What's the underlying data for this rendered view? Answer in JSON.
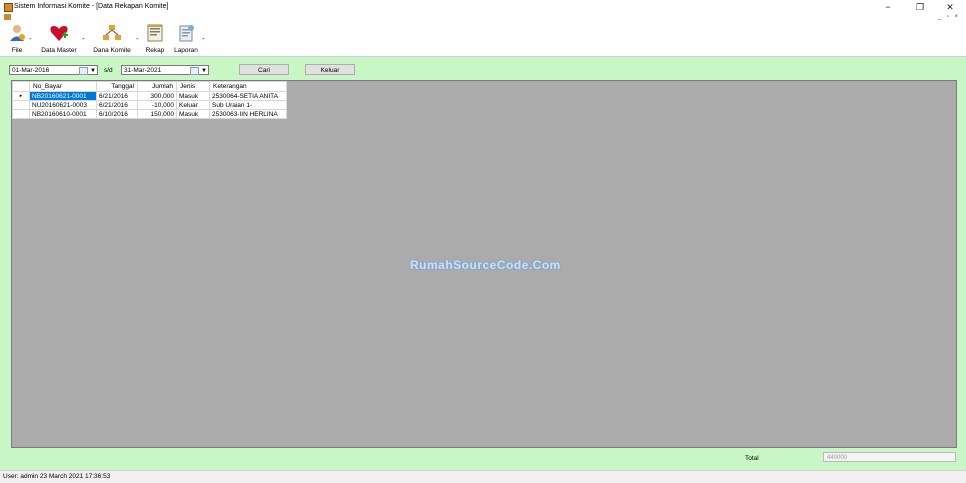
{
  "window": {
    "title": "Sistem Informasi Komite - [Data Rekapan Komite]",
    "minimize_glyph": "−",
    "restore_glyph": "❐",
    "close_glyph": "✕",
    "mdi_controls": "_ ▫ ×"
  },
  "toolbar": {
    "items": [
      {
        "label": "File",
        "icon": "user-icon"
      },
      {
        "label": "Data Master",
        "icon": "heart-add-icon"
      },
      {
        "label": "Dana Komite",
        "icon": "network-icon"
      },
      {
        "label": "Rekap",
        "icon": "report-icon"
      },
      {
        "label": "Laporan",
        "icon": "document-icon"
      }
    ],
    "separator": "-"
  },
  "filter": {
    "date_from": "01-Mar-2016",
    "between_label": "s/d",
    "date_to": "31-Mar-2021",
    "search_label": "Cari",
    "exit_label": "Keluar"
  },
  "table": {
    "columns": [
      "No_Bayar",
      "Tanggal",
      "Jumlah",
      "Jenis",
      "Keterangan"
    ],
    "rows": [
      {
        "no_bayar": "NB20160621-0001",
        "tanggal": "6/21/2016",
        "jumlah": "300,000",
        "jenis": "Masuk",
        "keterangan": "2530064-SETIA ANITA"
      },
      {
        "no_bayar": "NU20160621-0003",
        "tanggal": "6/21/2016",
        "jumlah": "-10,000",
        "jenis": "Keluar",
        "keterangan": "Sub Uraian 1-"
      },
      {
        "no_bayar": "NB20160610-0001",
        "tanggal": "6/10/2016",
        "jumlah": "150,000",
        "jenis": "Masuk",
        "keterangan": "2530063-IIN HERLINA"
      }
    ],
    "current_row_marker": "▸"
  },
  "watermark": "RumahSourceCode.Com",
  "total": {
    "label": "Total",
    "value": "440000"
  },
  "status": {
    "text": "User: admin  23 March 2021 17:36:53"
  },
  "colors": {
    "panel_bg": "#c8f7c5",
    "grid_bg": "#ababab",
    "selection": "#0078d7"
  }
}
